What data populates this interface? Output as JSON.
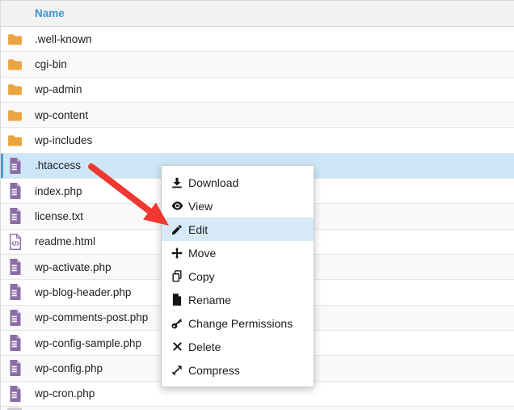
{
  "table": {
    "header": {
      "name_label": "Name"
    },
    "rows": [
      {
        "name": ".well-known",
        "type": "folder",
        "selected": false
      },
      {
        "name": "cgi-bin",
        "type": "folder",
        "selected": false
      },
      {
        "name": "wp-admin",
        "type": "folder",
        "selected": false
      },
      {
        "name": "wp-content",
        "type": "folder",
        "selected": false
      },
      {
        "name": "wp-includes",
        "type": "folder",
        "selected": false
      },
      {
        "name": ".htaccess",
        "type": "file",
        "selected": true
      },
      {
        "name": "index.php",
        "type": "file",
        "selected": false
      },
      {
        "name": "license.txt",
        "type": "file",
        "selected": false
      },
      {
        "name": "readme.html",
        "type": "html",
        "selected": false
      },
      {
        "name": "wp-activate.php",
        "type": "file",
        "selected": false
      },
      {
        "name": "wp-blog-header.php",
        "type": "file",
        "selected": false
      },
      {
        "name": "wp-comments-post.php",
        "type": "file",
        "selected": false
      },
      {
        "name": "wp-config-sample.php",
        "type": "file",
        "selected": false
      },
      {
        "name": "wp-config.php",
        "type": "file",
        "selected": false
      },
      {
        "name": "wp-cron.php",
        "type": "file",
        "selected": false
      }
    ]
  },
  "context_menu": {
    "items": [
      {
        "label": "Download",
        "icon": "download-icon",
        "highlighted": false
      },
      {
        "label": "View",
        "icon": "eye-icon",
        "highlighted": false
      },
      {
        "label": "Edit",
        "icon": "pencil-icon",
        "highlighted": true
      },
      {
        "label": "Move",
        "icon": "move-icon",
        "highlighted": false
      },
      {
        "label": "Copy",
        "icon": "copy-icon",
        "highlighted": false
      },
      {
        "label": "Rename",
        "icon": "rename-icon",
        "highlighted": false
      },
      {
        "label": "Change Permissions",
        "icon": "key-icon",
        "highlighted": false
      },
      {
        "label": "Delete",
        "icon": "delete-icon",
        "highlighted": false
      },
      {
        "label": "Compress",
        "icon": "compress-icon",
        "highlighted": false
      }
    ]
  },
  "colors": {
    "header_text_blue": "#3a96d2",
    "selected_row_bg": "#cde7f8",
    "selected_row_bar": "#4f9bcb",
    "menu_highlight_bg": "#d7eaf7",
    "folder_icon": "#eaa440",
    "file_icon_purple": "#8a6ca6",
    "annotation_arrow_red": "#ee3831"
  }
}
